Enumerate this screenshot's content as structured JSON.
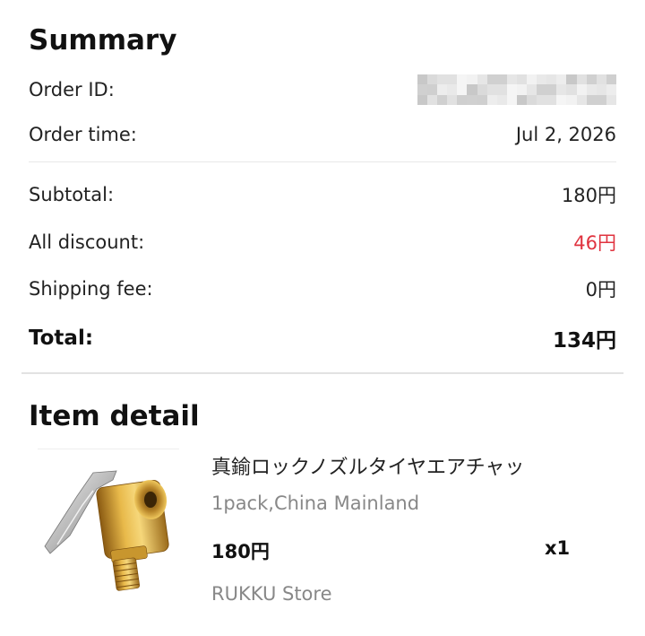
{
  "summary": {
    "title": "Summary",
    "order_id_label": "Order ID:",
    "order_time_label": "Order time:",
    "order_time": "Jul 2, 2026",
    "subtotal_label": "Subtotal:",
    "subtotal": "180円",
    "discount_label": "All discount:",
    "discount": "46円",
    "shipping_label": "Shipping fee:",
    "shipping": "0円",
    "total_label": "Total:",
    "total": "134円"
  },
  "item_detail": {
    "title": "Item detail",
    "item": {
      "name": "真鍮ロックノズルタイヤエアチャッ",
      "variant": "1pack,China Mainland",
      "price": "180円",
      "quantity": "x1",
      "store": "RUKKU Store",
      "image_icon": "brass-air-chuck-image"
    }
  },
  "colors": {
    "discount": "#e0333f",
    "divider": "#e2e2e2",
    "muted_text": "#888888"
  }
}
